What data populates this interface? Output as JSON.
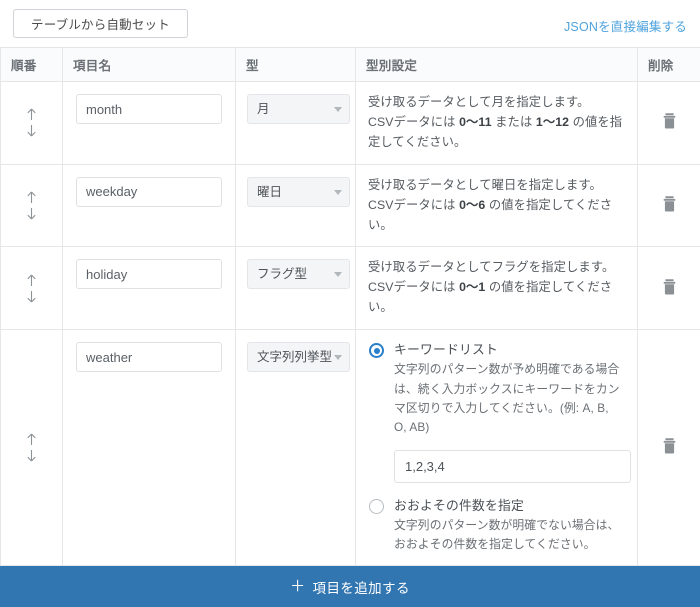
{
  "toolbar": {
    "auto_set_label": "テーブルから自動セット",
    "json_edit_label": "JSONを直接編集する"
  },
  "table": {
    "headers": {
      "order": "順番",
      "name": "項目名",
      "type": "型",
      "type_setting": "型別設定",
      "delete": "削除"
    },
    "rows": [
      {
        "name_value": "month",
        "type_value": "月",
        "desc_line1": "受け取るデータとして月を指定します。",
        "desc_line2_a": "CSVデータには ",
        "desc_line2_b": "0〜11",
        "desc_line2_c": " または ",
        "desc_line2_d": "1〜12",
        "desc_line2_e": " の値を指定してください。"
      },
      {
        "name_value": "weekday",
        "type_value": "曜日",
        "desc_line1": "受け取るデータとして曜日を指定します。",
        "desc_line2_a": "CSVデータには ",
        "desc_line2_b": "0〜6",
        "desc_line2_e": " の値を指定してください。"
      },
      {
        "name_value": "holiday",
        "type_value": "フラグ型",
        "desc_line1": "受け取るデータとしてフラグを指定します。",
        "desc_line2_a": "CSVデータには ",
        "desc_line2_b": "0〜1",
        "desc_line2_e": " の値を指定してください。"
      }
    ],
    "enum_row": {
      "name_value": "weather",
      "type_value": "文字列列挙型",
      "option_keyword_label": "キーワードリスト",
      "option_keyword_desc": "文字列のパターン数が予め明確である場合は、続く入力ボックスにキーワードをカンマ区切りで入力してください。(例: A, B, O, AB)",
      "keyword_input_value": "1,2,3,4",
      "option_count_label": "おおよその件数を指定",
      "option_count_desc": "文字列のパターン数が明確でない場合は、おおよその件数を指定してください。",
      "selected_option": "keyword"
    }
  },
  "footer": {
    "add_plus": "＋",
    "add_label": "項目を追加する"
  },
  "icons": {
    "arrow_up": "arrow-up-icon",
    "arrow_down": "arrow-down-icon",
    "trash": "trash-icon",
    "caret_down": "chevron-down-icon"
  },
  "colors": {
    "accent_blue": "#3276b1",
    "link_blue": "#4fa3dd",
    "radio_blue": "#2a7fc9",
    "border_grey": "#e4e6e8"
  }
}
